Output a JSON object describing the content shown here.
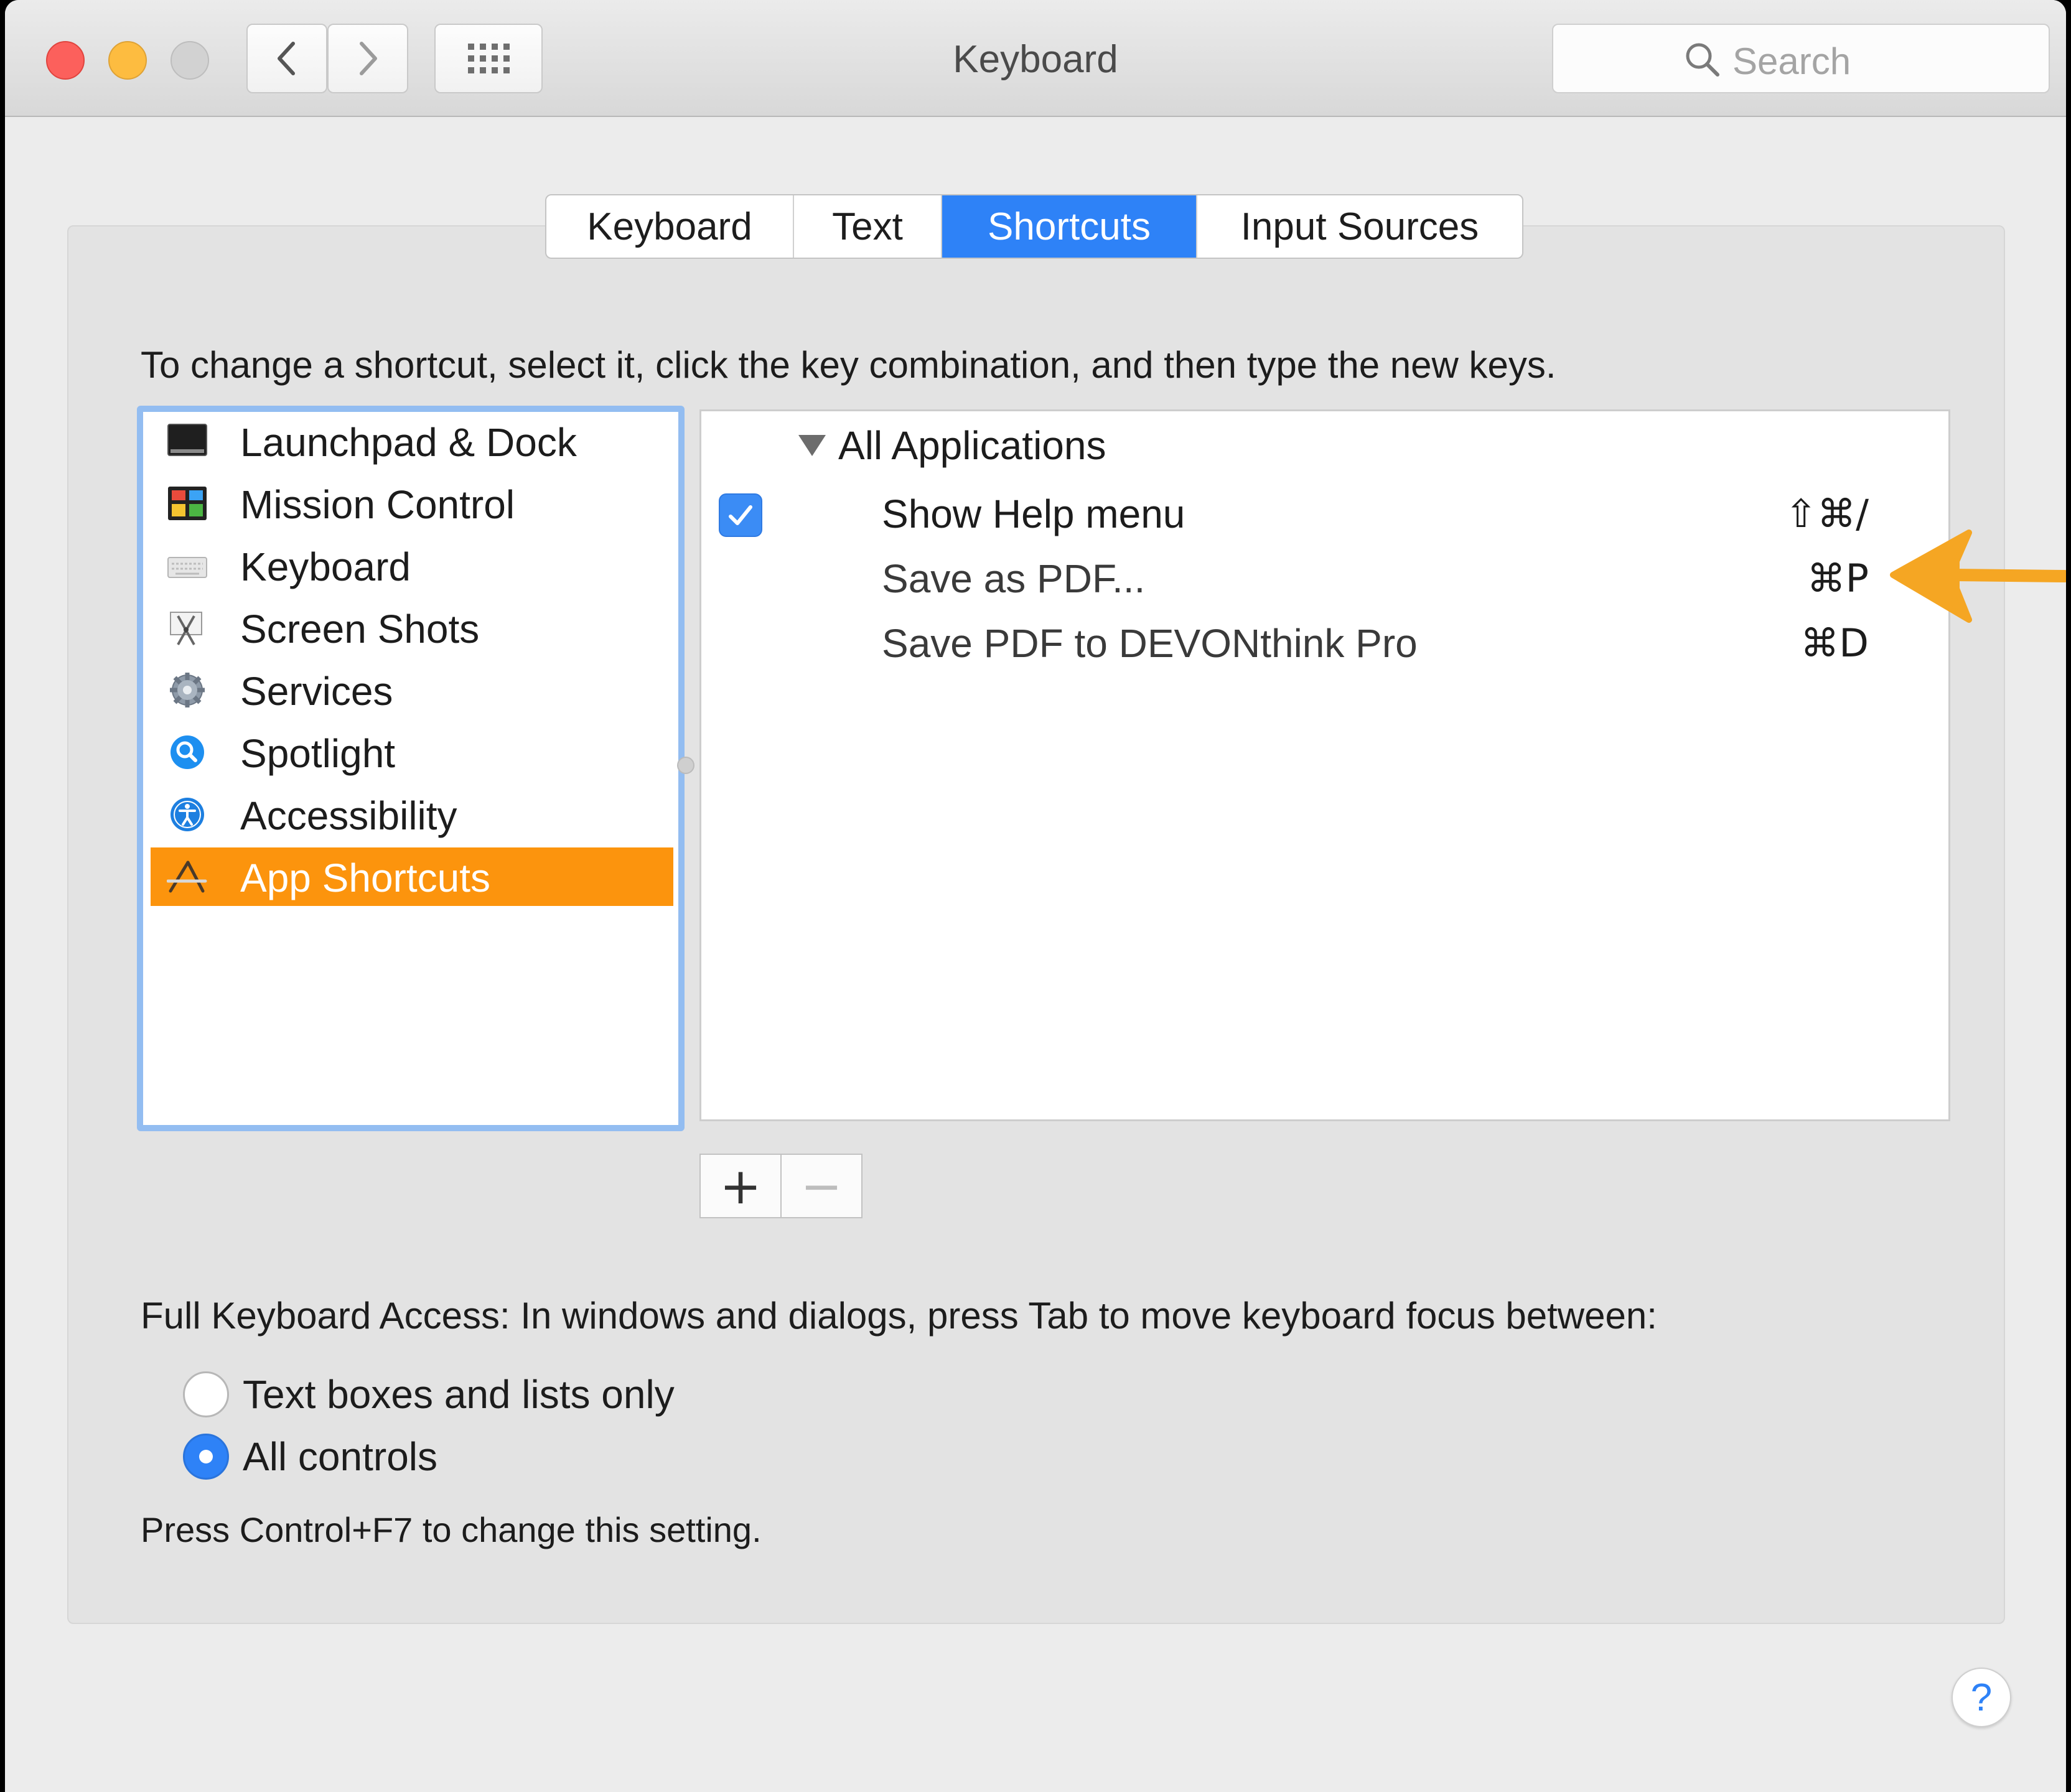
{
  "window": {
    "title": "Keyboard"
  },
  "search": {
    "placeholder": "Search"
  },
  "tabs": [
    {
      "label": "Keyboard",
      "active": false
    },
    {
      "label": "Text",
      "active": false
    },
    {
      "label": "Shortcuts",
      "active": true
    },
    {
      "label": "Input Sources",
      "active": false
    }
  ],
  "instruction": "To change a shortcut, select it, click the key combination, and then type the new keys.",
  "categories": [
    {
      "label": "Launchpad & Dock",
      "icon": "launchpad-dock-icon"
    },
    {
      "label": "Mission Control",
      "icon": "mission-control-icon"
    },
    {
      "label": "Keyboard",
      "icon": "keyboard-icon"
    },
    {
      "label": "Screen Shots",
      "icon": "screen-shots-icon"
    },
    {
      "label": "Services",
      "icon": "services-gear-icon"
    },
    {
      "label": "Spotlight",
      "icon": "spotlight-icon"
    },
    {
      "label": "Accessibility",
      "icon": "accessibility-icon"
    },
    {
      "label": "App Shortcuts",
      "icon": "app-shortcuts-icon",
      "selected": true
    }
  ],
  "shortcuts": {
    "group": "All Applications",
    "items": [
      {
        "label": "Show Help menu",
        "key": "⇧⌘/",
        "checked": true
      },
      {
        "label": "Save as PDF...",
        "key": "⌘P"
      },
      {
        "label": "Save PDF to DEVONthink Pro",
        "key": "⌘D"
      }
    ]
  },
  "buttons": {
    "add": "+",
    "remove": "−"
  },
  "full_keyboard_access": {
    "label": "Full Keyboard Access: In windows and dialogs, press Tab to move keyboard focus between:",
    "options": [
      {
        "label": "Text boxes and lists only",
        "selected": false
      },
      {
        "label": "All controls",
        "selected": true
      }
    ],
    "hint": "Press Control+F7 to change this setting."
  },
  "help": {
    "label": "?"
  },
  "colors": {
    "accent": "#2e82f7",
    "selection": "#fc940d",
    "annotation_arrow": "#f5a623"
  }
}
